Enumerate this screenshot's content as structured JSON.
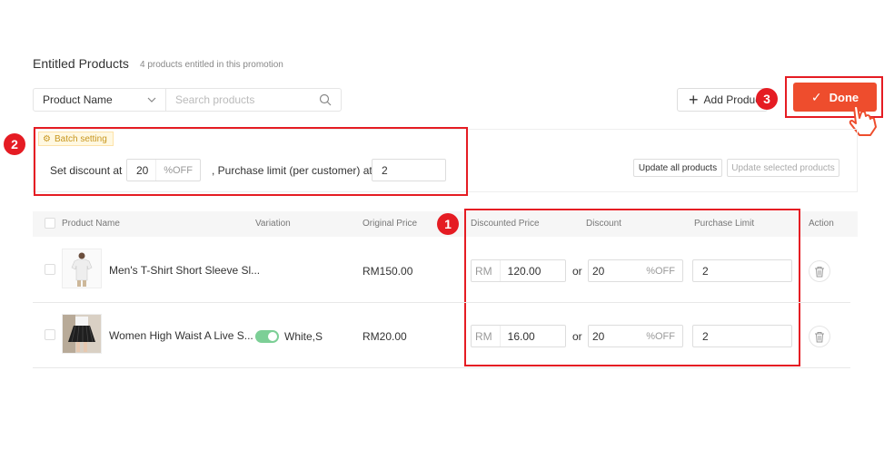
{
  "header": {
    "title": "Entitled Products",
    "subtitle": "4 products entitled in this promotion"
  },
  "filter": {
    "select_value": "Product Name",
    "search_placeholder": "Search products"
  },
  "actions": {
    "add_label": "Add Products",
    "done_label": "Done"
  },
  "badges": [
    "1",
    "2",
    "3"
  ],
  "batch": {
    "tag": "Batch setting",
    "discount_label": "Set discount at",
    "discount_value": "20",
    "discount_suffix": "%OFF",
    "limit_label": ", Purchase limit (per customer) at",
    "limit_value": "2",
    "update_all": "Update all products",
    "update_selected": "Update selected products"
  },
  "table": {
    "columns": [
      "Product Name",
      "Variation",
      "Original Price",
      "Discounted Price",
      "Discount",
      "Purchase Limit",
      "Action"
    ],
    "rows": [
      {
        "name": "Men's T-Shirt Short Sleeve Sl...",
        "variation": "",
        "original_price": "RM150.00",
        "currency": "RM",
        "discounted_price": "120.00",
        "or": "or",
        "discount": "20",
        "discount_suffix": "%OFF",
        "limit": "2"
      },
      {
        "name": "Women High Waist A Live S...",
        "variation": "White,S",
        "original_price": "RM20.00",
        "currency": "RM",
        "discounted_price": "16.00",
        "or": "or",
        "discount": "20",
        "discount_suffix": "%OFF",
        "limit": "2"
      }
    ]
  },
  "colors": {
    "accent": "#ee4d2d",
    "highlight": "#e51c23",
    "toggle": "#7ccf96"
  }
}
